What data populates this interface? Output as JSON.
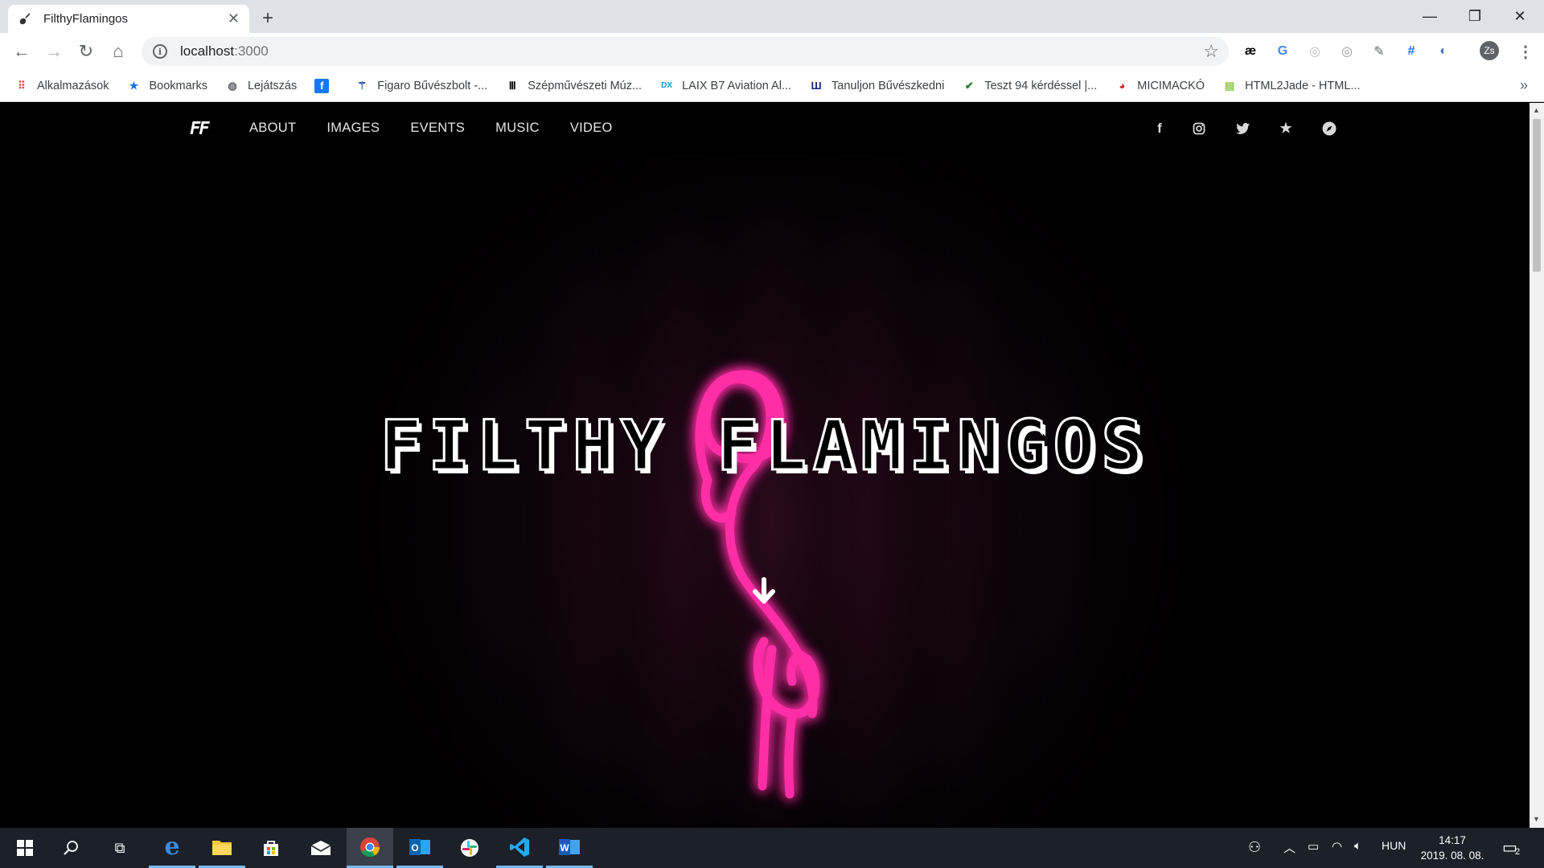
{
  "browser": {
    "tab_title": "FilthyFlamingos",
    "url_host": "localhost",
    "url_port": ":3000",
    "avatar_initials": "Zs",
    "bookmarks": [
      {
        "label": "Alkalmazások",
        "icon": "apps-grid-icon",
        "color": "#ea4335"
      },
      {
        "label": "Bookmarks",
        "icon": "star-icon",
        "color": "#1a73e8"
      },
      {
        "label": "Lejátszás",
        "icon": "globe-icon",
        "color": "#5f6368"
      },
      {
        "label": "",
        "icon": "facebook-icon",
        "color": "#1877f2"
      },
      {
        "label": "Figaro Bűvészbolt -...",
        "icon": "figaro-icon",
        "color": "#1a4aa0"
      },
      {
        "label": "Szépművészeti Múz...",
        "icon": "museum-icon",
        "color": "#000000"
      },
      {
        "label": "LAIX B7 Aviation Al...",
        "icon": "dx-icon",
        "color": "#00a0d2"
      },
      {
        "label": "Tanuljon Bűvészkedni",
        "icon": "tanuljon-icon",
        "color": "#1a237e"
      },
      {
        "label": "Teszt 94 kérdéssel |...",
        "icon": "check-icon",
        "color": "#2e7d32"
      },
      {
        "label": "MICIMACKÓ",
        "icon": "micimacko-icon",
        "color": "#c62828"
      },
      {
        "label": "HTML2Jade - HTML...",
        "icon": "html2jade-icon",
        "color": "#8bc34a"
      }
    ]
  },
  "site": {
    "logo": "FF",
    "menu": [
      "ABOUT",
      "IMAGES",
      "EVENTS",
      "MUSIC",
      "VIDEO"
    ],
    "social_icons": [
      "facebook-icon",
      "instagram-icon",
      "twitter-icon",
      "star-icon",
      "compass-icon"
    ],
    "hero_title": "FILTHY FLAMINGOS",
    "neon_color": "#ff2ea6"
  },
  "taskbar": {
    "language": "HUN",
    "time": "14:17",
    "date": "2019. 08. 08.",
    "notification_count": "2"
  }
}
